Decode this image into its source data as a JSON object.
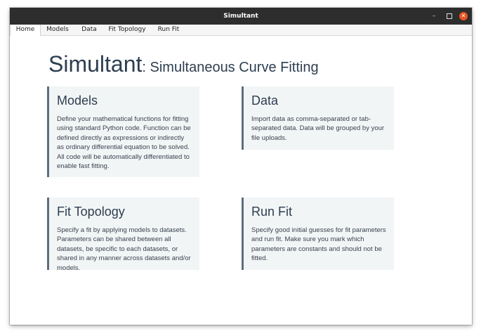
{
  "window": {
    "title": "Simultant"
  },
  "menu": {
    "items": [
      {
        "label": "Home",
        "active": true
      },
      {
        "label": "Models",
        "active": false
      },
      {
        "label": "Data",
        "active": false
      },
      {
        "label": "Fit Topology",
        "active": false
      },
      {
        "label": "Run Fit",
        "active": false
      }
    ]
  },
  "heading": {
    "app_name": "Simultant",
    "subtitle": ": Simultaneous Curve Fitting"
  },
  "cards": [
    {
      "title": "Models",
      "body": "Define your mathematical functions for fitting using standard Python code. Function can be defined directly as expressions or indirectly as ordinary differential equation to be solved. All code will be automatically differentiated to enable fast fitting."
    },
    {
      "title": "Data",
      "body": "Import data as comma-separated or tab-separated data. Data will be grouped by your file uploads."
    },
    {
      "title": "Fit Topology",
      "body": "Specify a fit by applying models to datasets. Parameters can be shared between all datasets, be specific to each datasets, or shared in any manner across datasets and/or models."
    },
    {
      "title": "Run Fit",
      "body": "Specify good initial guesses for fit parameters and run fit. Make sure you mark which parameters are constants and should not be fitted."
    }
  ],
  "colors": {
    "titlebar": "#2d2d2d",
    "close_button": "#e95420",
    "heading_text": "#2d3e50",
    "card_background": "#f2f5f6",
    "card_accent": "#5e6e7c"
  }
}
